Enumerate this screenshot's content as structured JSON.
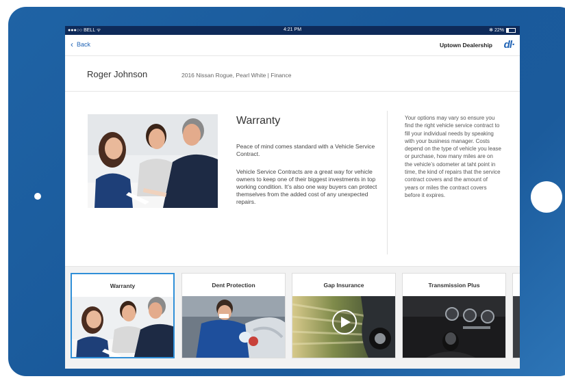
{
  "status_bar": {
    "carrier": "●●●○○ BELL ᯤ",
    "time": "4:21 PM",
    "battery": "✻ 22%"
  },
  "nav": {
    "back_label": "Back",
    "dealership": "Uptown Dealership",
    "logo_text": "dl·"
  },
  "customer": {
    "name": "Roger Johnson",
    "vehicle": "2016 Nissan Rogue, Pearl White  |  Finance"
  },
  "detail": {
    "title": "Warranty",
    "paragraph1": "Peace of mind comes standard with a Vehicle Service Contract.",
    "paragraph2": "Vehicle Service Contracts are a great way for vehicle owners to keep one of their biggest investments in top working condition. It’s also one way buyers can protect themselves from the added cost of any unexpected repairs.",
    "side_note": "Your options may vary so ensure you find the right vehicle service contract to fill your individual needs by speaking with your business manager. Costs depend on the type of vehicle you lease or purchase, how many miles are on the vehicle’s odometer at taht point in time, the kind of repairs that the service contract covers and the amount of years or miles the contract covers before it expires."
  },
  "products": [
    {
      "label": "Warranty",
      "selected": true,
      "image": "people-signing-contract-photo"
    },
    {
      "label": "Dent Protection",
      "selected": false,
      "image": "mechanic-repairing-car-photo"
    },
    {
      "label": "Gap Insurance",
      "selected": false,
      "image": "motion-blur-car-video",
      "has_video": true
    },
    {
      "label": "Transmission Plus",
      "selected": false,
      "image": "car-dashboard-gearshift-photo"
    }
  ],
  "colors": {
    "accent": "#1f63b5",
    "status_bar": "#0e2a59",
    "tablet_frame": "#1f63a5",
    "selected_border": "#2f8fd8"
  }
}
